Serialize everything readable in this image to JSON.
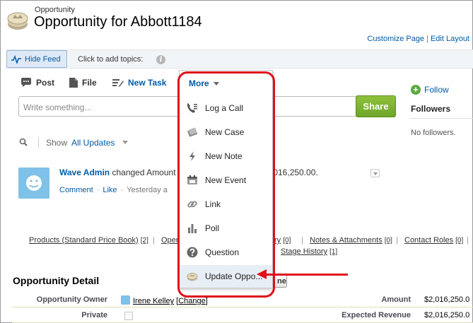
{
  "header": {
    "object_label": "Opportunity",
    "title": "Opportunity for Abbott1184",
    "customize_page": "Customize Page",
    "link_separator": "|",
    "edit_layout": "Edit Layout"
  },
  "feed_toolbar": {
    "hide_feed": "Hide Feed",
    "add_topics": "Click to add topics:",
    "info_glyph": "i"
  },
  "publisher": {
    "tabs": [
      {
        "label": "Post",
        "icon": "speech-bubble-icon"
      },
      {
        "label": "File",
        "icon": "document-icon"
      },
      {
        "label": "New Task",
        "icon": "pencil-icon"
      }
    ],
    "placeholder": "Write something...",
    "share": "Share"
  },
  "sidebar": {
    "follow": "Follow",
    "followers_heading": "Followers",
    "no_followers": "No followers."
  },
  "feed_filter": {
    "show_label": "Show",
    "show_value": "All Updates"
  },
  "feed_item": {
    "actor": "Wave Admin",
    "text": "changed Amount",
    "amount_tail": ",016,250.00.",
    "actions": {
      "comment": "Comment",
      "like": "Like",
      "time": "Yesterday a"
    },
    "dot": "·"
  },
  "related_links": {
    "separator": "|",
    "row1": [
      {
        "label": "Products (Standard Price Book)",
        "count": "[2]"
      },
      {
        "label": "Oper",
        "count": ""
      },
      {
        "label": "ry",
        "count": "[0]"
      },
      {
        "label": "Notes & Attachments",
        "count": "[0]"
      },
      {
        "label": "Contact Roles",
        "count": "[0]"
      }
    ],
    "row2": [
      {
        "label": "Stage History",
        "count": "[1]"
      }
    ]
  },
  "detail": {
    "heading": "Opportunity Detail",
    "hidden_button": "ne",
    "change_prefix": "[",
    "change_label": "Change",
    "change_suffix": "]",
    "fields": [
      {
        "label": "Opportunity Owner",
        "value": "Irene Kelley"
      },
      {
        "label": "Private",
        "value": ""
      },
      {
        "label": "Amount",
        "value": "$2,016,250.0"
      },
      {
        "label": "Expected Revenue",
        "value": "$2,016,250.0"
      }
    ]
  },
  "more_menu": {
    "label": "More",
    "items": [
      {
        "label": "Log a Call",
        "icon": "phone-icon"
      },
      {
        "label": "New Case",
        "icon": "case-icon"
      },
      {
        "label": "New Note",
        "icon": "lightning-icon"
      },
      {
        "label": "New Event",
        "icon": "calendar-icon"
      },
      {
        "label": "Link",
        "icon": "link-icon"
      },
      {
        "label": "Poll",
        "icon": "bar-chart-icon"
      },
      {
        "label": "Question",
        "icon": "question-icon"
      },
      {
        "label": "Update Oppo...",
        "icon": "opportunity-icon"
      }
    ]
  },
  "colors": {
    "link": "#015ba7",
    "share_green": "#6ea52a",
    "highlight_red": "#e0101a",
    "avatar_blue": "#7fc1e8"
  }
}
